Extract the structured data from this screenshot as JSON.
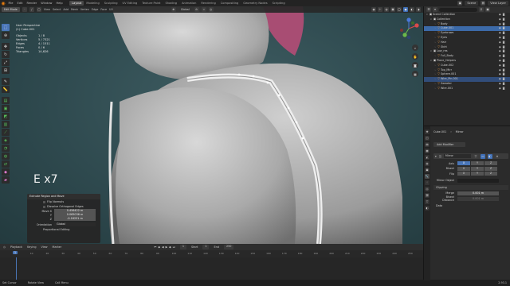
{
  "app": {
    "menus": [
      "File",
      "Edit",
      "Render",
      "Window",
      "Help"
    ],
    "workspaces": [
      "Layout",
      "Modeling",
      "Sculpting",
      "UV Editing",
      "Texture Paint",
      "Shading",
      "Animation",
      "Rendering",
      "Compositing",
      "Geometry Nodes",
      "Scripting"
    ],
    "active_workspace": "Layout",
    "scene_name": "Scene",
    "view_layer": "View Layer"
  },
  "viewport": {
    "mode": "Edit Mode",
    "header_menus": [
      "View",
      "Select",
      "Add",
      "Mesh",
      "Vertex",
      "Edge",
      "Face",
      "UV"
    ],
    "orientation": "Global",
    "view_label": "User Perspective",
    "object_label": "(1) Cube.001",
    "stats": [
      {
        "label": "Objects",
        "value": "1 / 8"
      },
      {
        "label": "Vertices",
        "value": "5 / 7321"
      },
      {
        "label": "Edges",
        "value": "4 / 1511"
      },
      {
        "label": "Faces",
        "value": "0 / 6"
      },
      {
        "label": "Triangles",
        "value": "14,626"
      }
    ],
    "operator_text": "E x7"
  },
  "redo_panel": {
    "title": "Extrude Region and Move",
    "options": [
      "Flip Normals",
      "Dissolve Orthogonal Edges"
    ],
    "move_label": "Move X",
    "move_values": [
      {
        "axis": "Move X",
        "value": "0.456422 m"
      },
      {
        "axis": "Y",
        "value": "0.065036 m"
      },
      {
        "axis": "Z",
        "value": "-0.18231 m"
      }
    ],
    "orientation_label": "Orientation",
    "orientation_value": "Global",
    "proportional": "Proportional Editing"
  },
  "timeline": {
    "menus": [
      "Playback",
      "Keying",
      "View",
      "Marker"
    ],
    "current_frame": "1",
    "start_label": "Start",
    "start": "1",
    "end_label": "End",
    "end": "250",
    "ticks": [
      "0",
      "10",
      "20",
      "30",
      "40",
      "50",
      "60",
      "70",
      "80",
      "90",
      "100",
      "110",
      "120",
      "130",
      "140",
      "150",
      "160",
      "170",
      "180",
      "190",
      "200",
      "210",
      "220",
      "230",
      "240",
      "250"
    ]
  },
  "statusbar": {
    "items": [
      "Set Cursor",
      "Rotate View",
      "Call Menu"
    ],
    "version": "2.93.1"
  },
  "outliner": {
    "rows": [
      {
        "name": "Scene Collection",
        "depth": 0,
        "icon": "▣",
        "state": ""
      },
      {
        "name": "Collection",
        "depth": 1,
        "icon": "▣",
        "state": ""
      },
      {
        "name": "Body",
        "depth": 2,
        "icon": "▽",
        "state": ""
      },
      {
        "name": "Cube.001",
        "depth": 2,
        "icon": "▽",
        "state": "active"
      },
      {
        "name": "Eyebrows",
        "depth": 2,
        "icon": "▽",
        "state": ""
      },
      {
        "name": "Eyes",
        "depth": 2,
        "icon": "▽",
        "state": ""
      },
      {
        "name": "Hair",
        "depth": 2,
        "icon": "▽",
        "state": ""
      },
      {
        "name": "Skirt",
        "depth": 2,
        "icon": "▽",
        "state": ""
      },
      {
        "name": "Low_res",
        "depth": 1,
        "icon": "▣",
        "state": ""
      },
      {
        "name": "Full_Body",
        "depth": 2,
        "icon": "▽",
        "state": ""
      },
      {
        "name": "Plane_Helpers",
        "depth": 1,
        "icon": "▣",
        "state": ""
      },
      {
        "name": "Cube.002",
        "depth": 2,
        "icon": "▽",
        "state": ""
      },
      {
        "name": "Top_Mirr",
        "depth": 2,
        "icon": "▽",
        "state": ""
      },
      {
        "name": "Sphere.001",
        "depth": 2,
        "icon": "▽",
        "state": ""
      },
      {
        "name": "Wire_Pin.001",
        "depth": 2,
        "icon": "▽",
        "state": "sel"
      },
      {
        "name": "Sweater",
        "depth": 2,
        "icon": "▽",
        "state": ""
      },
      {
        "name": "Wire.001",
        "depth": 2,
        "icon": "▽",
        "state": ""
      }
    ]
  },
  "properties": {
    "object": "Cube.001",
    "modifier_type": "Mirror",
    "add_modifier": "Add Modifier",
    "modifier_name": "Mirror",
    "axis_label": "Axis",
    "bisect_label": "Bisect",
    "flip_label": "Flip",
    "axes": [
      "X",
      "Y",
      "Z"
    ],
    "mirror_object": "Mirror Object",
    "clipping": "Clipping",
    "merge_label": "Merge",
    "merge_value": "0.001 m",
    "bisect_distance_label": "Bisect Distance",
    "bisect_distance_value": "0.001 m",
    "data": "Data"
  }
}
